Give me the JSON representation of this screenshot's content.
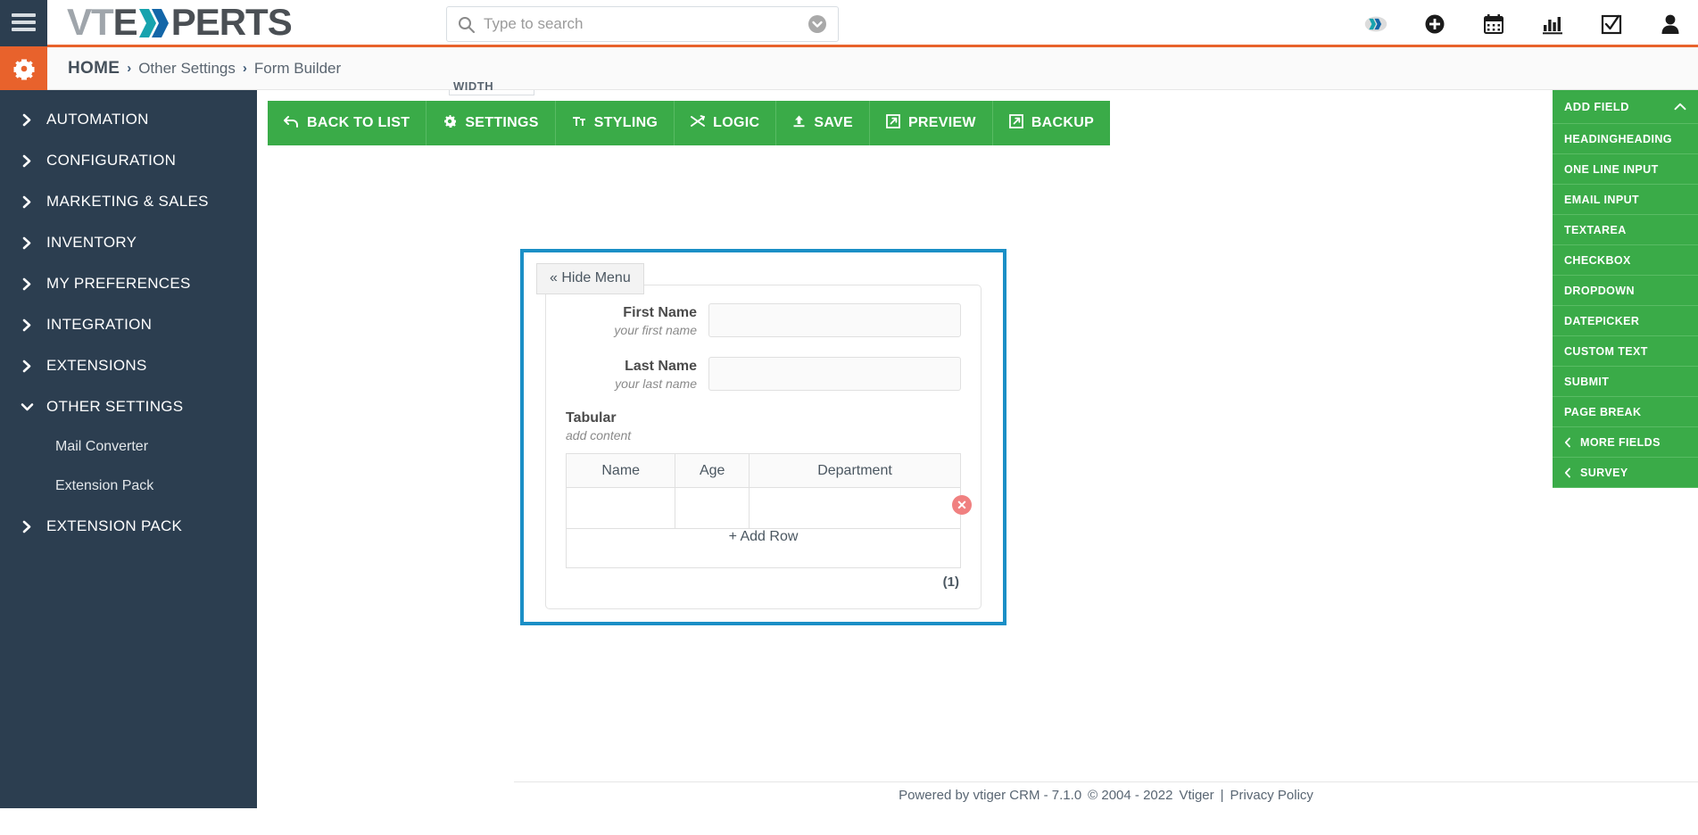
{
  "brand": {
    "part1": "VT",
    "part2": "E",
    "part3": "PERTS",
    "logo_icon": "vtexperts-x-logo"
  },
  "search": {
    "placeholder": "Type to search",
    "value": "",
    "icon": "search-icon",
    "caret_icon": "chevron-down-circle-icon"
  },
  "topbar": {
    "menu_icon": "hamburger-menu-icon",
    "icons": [
      {
        "name": "vtexperts-x-icon",
        "label": "VTExperts"
      },
      {
        "name": "add-circle-icon",
        "label": "Add"
      },
      {
        "name": "calendar-icon",
        "label": "Calendar"
      },
      {
        "name": "bar-chart-icon",
        "label": "Reports"
      },
      {
        "name": "checkbox-task-icon",
        "label": "Tasks"
      },
      {
        "name": "user-avatar-icon",
        "label": "User"
      }
    ]
  },
  "breadcrumb": {
    "gear_icon": "gear-icon",
    "items": [
      "HOME",
      "Other Settings",
      "Form Builder"
    ],
    "separator": "›"
  },
  "sidebar": {
    "items": [
      {
        "label": "AUTOMATION",
        "expanded": false
      },
      {
        "label": "CONFIGURATION",
        "expanded": false
      },
      {
        "label": "MARKETING & SALES",
        "expanded": false
      },
      {
        "label": "INVENTORY",
        "expanded": false
      },
      {
        "label": "MY PREFERENCES",
        "expanded": false
      },
      {
        "label": "INTEGRATION",
        "expanded": false
      },
      {
        "label": "EXTENSIONS",
        "expanded": false
      },
      {
        "label": "OTHER SETTINGS",
        "expanded": true
      },
      {
        "label": "EXTENSION PACK",
        "expanded": false
      }
    ],
    "sub_items": [
      "Mail Converter",
      "Extension Pack"
    ]
  },
  "toolbar": {
    "buttons": [
      {
        "label": "BACK TO LIST",
        "icon": "undo-arrow-icon"
      },
      {
        "label": "SETTINGS",
        "icon": "gear-icon"
      },
      {
        "label": "STYLING",
        "icon": "text-format-icon"
      },
      {
        "label": "LOGIC",
        "icon": "shuffle-icon"
      },
      {
        "label": "SAVE",
        "icon": "upload-icon"
      },
      {
        "label": "PREVIEW",
        "icon": "external-link-icon"
      },
      {
        "label": "BACKUP",
        "icon": "external-link-icon"
      }
    ],
    "ghost_label": "WIDTH"
  },
  "form": {
    "hide_menu_label": "« Hide Menu",
    "fields": [
      {
        "label": "First Name",
        "hint": "your first name",
        "value": "",
        "type": "text"
      },
      {
        "label": "Last Name",
        "hint": "your last name",
        "value": "",
        "type": "text"
      }
    ],
    "tabular": {
      "label": "Tabular",
      "hint": "add content",
      "columns": [
        "Name",
        "Age",
        "Department"
      ],
      "rows": [
        [
          "",
          "",
          ""
        ]
      ],
      "add_row_label": "+ Add Row",
      "delete_icon": "delete-row-icon",
      "page_count": "(1)"
    }
  },
  "right_panel": {
    "title": "ADD FIELD",
    "collapse_icon": "chevron-up-icon",
    "items": [
      {
        "label": "HEADINGHEADING",
        "has_chevron": false
      },
      {
        "label": "ONE LINE INPUT",
        "has_chevron": false
      },
      {
        "label": "EMAIL INPUT",
        "has_chevron": false
      },
      {
        "label": "TEXTAREA",
        "has_chevron": false
      },
      {
        "label": "CHECKBOX",
        "has_chevron": false
      },
      {
        "label": "DROPDOWN",
        "has_chevron": false
      },
      {
        "label": "DATEPICKER",
        "has_chevron": false
      },
      {
        "label": "CUSTOM TEXT",
        "has_chevron": false
      },
      {
        "label": "SUBMIT",
        "has_chevron": false
      },
      {
        "label": "PAGE BREAK",
        "has_chevron": false
      },
      {
        "label": "MORE FIELDS",
        "has_chevron": true
      },
      {
        "label": "SURVEY",
        "has_chevron": true
      }
    ]
  },
  "footer": {
    "powered": "Powered by vtiger CRM - 7.1.0",
    "copyright": "© 2004 - 2022",
    "vendor": "Vtiger",
    "divider": "|",
    "privacy": "Privacy Policy"
  },
  "colors": {
    "accent_orange": "#e8622c",
    "sidebar_dark": "#2c3e50",
    "green": "#3aab48",
    "form_border_blue": "#1b8fc6",
    "delete_red": "#f08080",
    "logo_teal": "#17a3ae",
    "logo_blue": "#1366a8"
  }
}
